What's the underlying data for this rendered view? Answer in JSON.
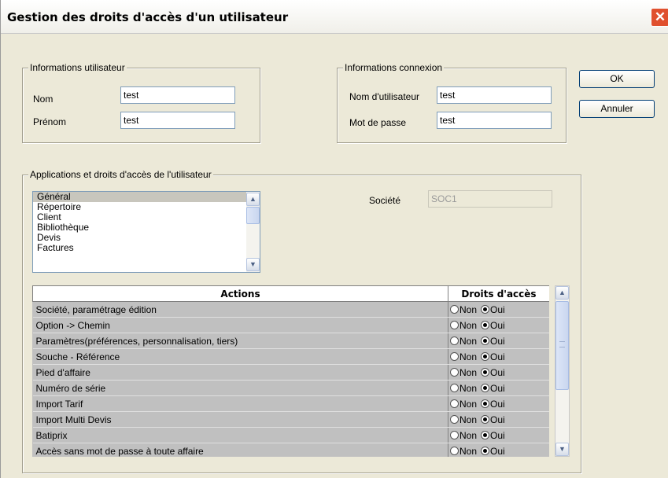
{
  "window": {
    "title": "Gestion des droits d'accès d'un utilisateur",
    "close_glyph": "✕"
  },
  "user_info": {
    "legend": "Informations utilisateur",
    "nom_label": "Nom",
    "nom_value": "test",
    "prenom_label": "Prénom",
    "prenom_value": "test"
  },
  "connexion_info": {
    "legend": "Informations connexion",
    "username_label": "Nom d'utilisateur",
    "username_value": "test",
    "password_label": "Mot de passe",
    "password_value": "test"
  },
  "buttons": {
    "ok": "OK",
    "annuler": "Annuler"
  },
  "apps": {
    "legend": "Applications et droits d'accès de l'utilisateur",
    "items": [
      "Général",
      "Répertoire",
      "Client",
      "Bibliothèque",
      "Devis",
      "Factures"
    ],
    "selected": "Général",
    "societe_label": "Société",
    "societe_value": "SOC1"
  },
  "rights_table": {
    "col_actions": "Actions",
    "col_rights": "Droits d'accès",
    "non_label": "Non",
    "oui_label": "Oui",
    "rows": [
      {
        "action": "Société, paramétrage édition",
        "value": "Oui"
      },
      {
        "action": "Option -> Chemin",
        "value": "Oui"
      },
      {
        "action": "Paramètres(préférences, personnalisation, tiers)",
        "value": "Oui"
      },
      {
        "action": "Souche - Référence",
        "value": "Oui"
      },
      {
        "action": "Pied d'affaire",
        "value": "Oui"
      },
      {
        "action": "Numéro de série",
        "value": "Oui"
      },
      {
        "action": "Import Tarif",
        "value": "Oui"
      },
      {
        "action": "Import Multi Devis",
        "value": "Oui"
      },
      {
        "action": "Batiprix",
        "value": "Oui"
      },
      {
        "action": "Accès sans mot de passe à toute affaire",
        "value": "Oui"
      }
    ]
  },
  "colors": {
    "dialog_bg": "#ece9d8",
    "grid_bg": "#c0c0c0",
    "close_red": "#e0502e"
  },
  "icons": [
    "close-icon",
    "scroll-up-arrow-icon",
    "scroll-down-arrow-icon",
    "scroll-grip-icon"
  ]
}
